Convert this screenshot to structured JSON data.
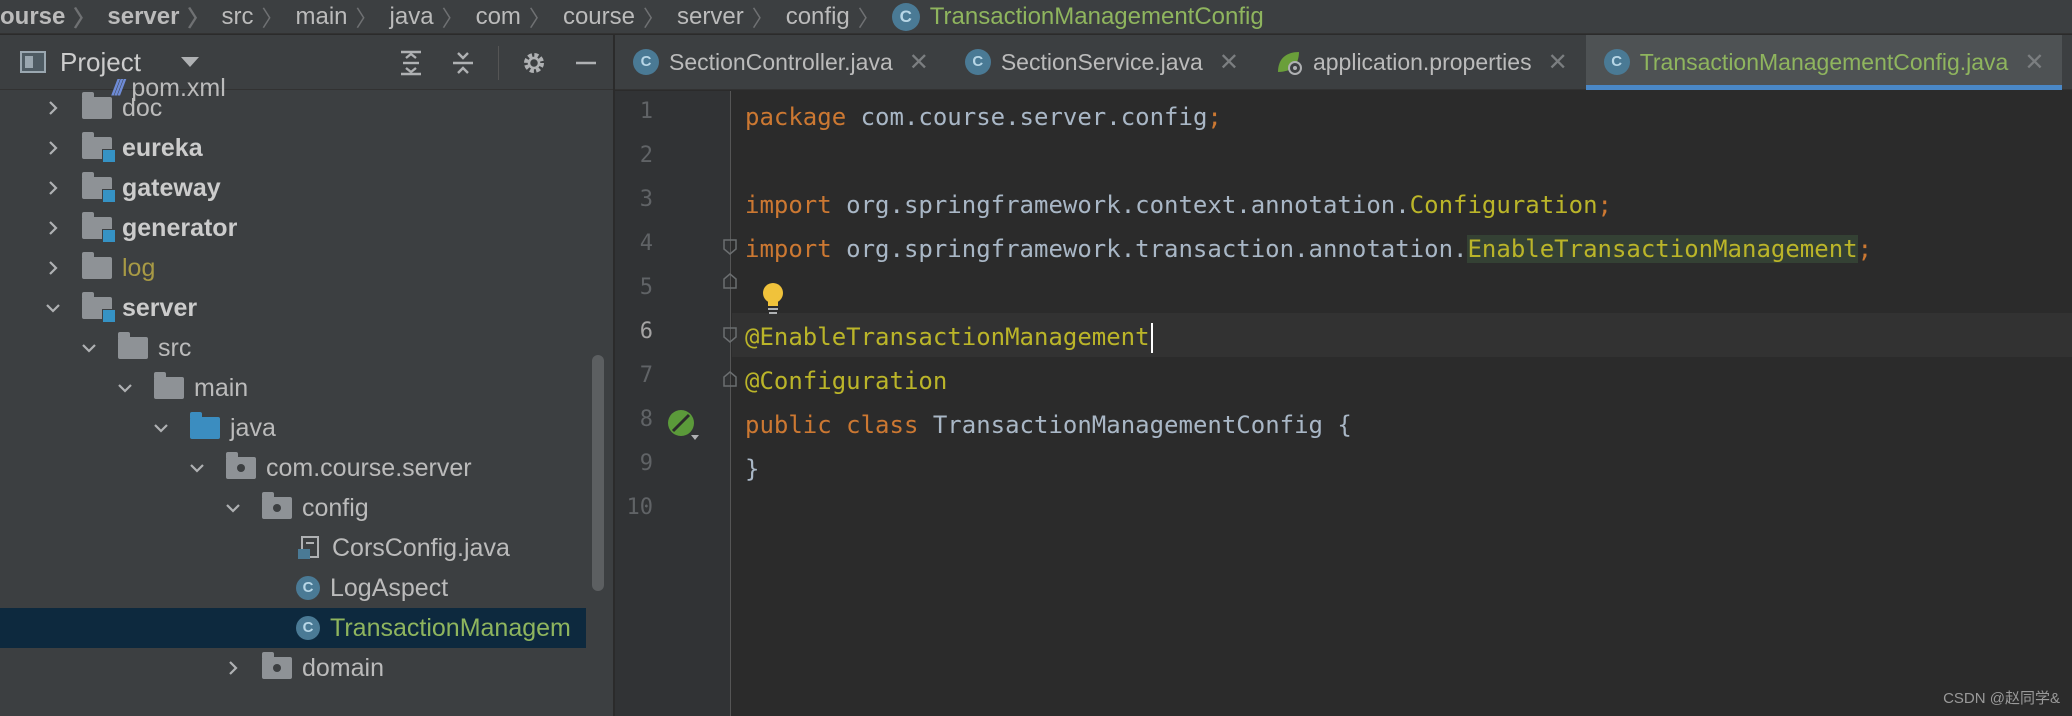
{
  "breadcrumb": {
    "items": [
      "ourse",
      "server",
      "src",
      "main",
      "java",
      "com",
      "course",
      "server",
      "config"
    ],
    "last": "TransactionManagementConfig",
    "icon": "class-c-icon"
  },
  "project_panel": {
    "title": "Project",
    "tree": [
      {
        "label": "pom.xml",
        "type": "pom"
      },
      {
        "label": "doc",
        "type": "folder"
      },
      {
        "label": "eureka",
        "type": "module"
      },
      {
        "label": "gateway",
        "type": "module"
      },
      {
        "label": "generator",
        "type": "module"
      },
      {
        "label": "log",
        "type": "folder-log"
      },
      {
        "label": "server",
        "type": "module-open"
      },
      {
        "label": "src",
        "type": "folder-open"
      },
      {
        "label": "main",
        "type": "folder-open"
      },
      {
        "label": "java",
        "type": "source-open"
      },
      {
        "label": "com.course.server",
        "type": "package-open"
      },
      {
        "label": "config",
        "type": "package-open"
      },
      {
        "label": "CorsConfig.java",
        "type": "java-file"
      },
      {
        "label": "LogAspect",
        "type": "class"
      },
      {
        "label": "TransactionManagem",
        "type": "class-selected"
      },
      {
        "label": "domain",
        "type": "package"
      }
    ]
  },
  "tabs": [
    {
      "label": "SectionController.java",
      "icon": "class-c-icon",
      "active": false
    },
    {
      "label": "SectionService.java",
      "icon": "class-c-icon",
      "active": false
    },
    {
      "label": "application.properties",
      "icon": "spring-leaf-icon",
      "active": false
    },
    {
      "label": "TransactionManagementConfig.java",
      "icon": "class-c-icon",
      "active": true
    }
  ],
  "editor": {
    "line_numbers": [
      "1",
      "2",
      "3",
      "4",
      "5",
      "6",
      "7",
      "8",
      "9",
      "10"
    ],
    "current_line": 6,
    "code": {
      "l1_kw": "package",
      "l1_rest": " com.course.server.config",
      "l1_semi": ";",
      "l3_kw": "import",
      "l3_pkg": " org.springframework.context.annotation.",
      "l3_cls": "Configuration",
      "l3_semi": ";",
      "l4_kw": "import",
      "l4_pkg": " org.springframework.transaction.annotation.",
      "l4_cls": "EnableTransactionManagement",
      "l4_semi": ";",
      "l6_ann": "@EnableTransactionManagement",
      "l7_ann": "@Configuration",
      "l8_kw1": "public",
      "l8_kw2": " class",
      "l8_name": " TransactionManagementConfig {",
      "l9": "}"
    }
  },
  "watermark": "CSDN @赵同学&",
  "colors": {
    "keyword": "#cc7832",
    "annotation": "#bbb529",
    "selected_text": "#8fb55e",
    "tab_underline": "#4a88c7"
  }
}
